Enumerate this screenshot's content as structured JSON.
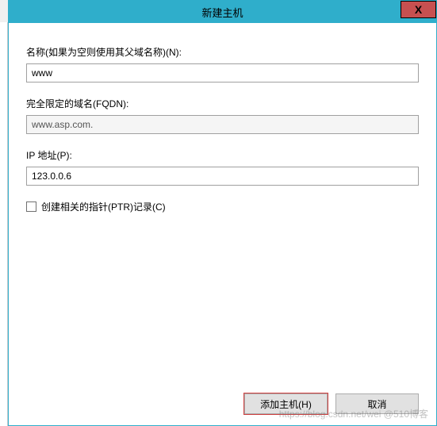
{
  "window": {
    "title": "新建主机"
  },
  "fields": {
    "name": {
      "label": "名称(如果为空则使用其父域名称)(N):",
      "value": "www"
    },
    "fqdn": {
      "label": "完全限定的域名(FQDN):",
      "value": "www.asp.com."
    },
    "ip": {
      "label": "IP 地址(P):",
      "value": "123.0.0.6"
    },
    "ptr": {
      "label": "创建相关的指针(PTR)记录(C)"
    }
  },
  "buttons": {
    "add_host": "添加主机(H)",
    "cancel": "取消"
  },
  "close_icon": "X",
  "watermark": "https://blog.csdn.net/wei @510博客"
}
